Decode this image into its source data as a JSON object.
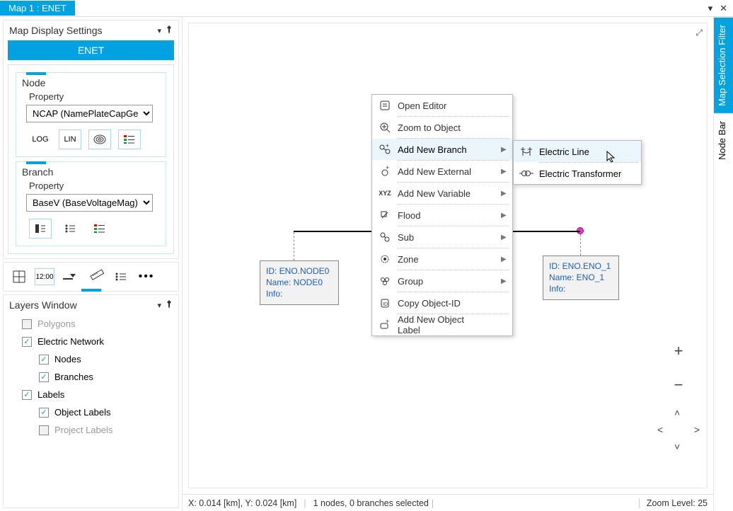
{
  "tab": {
    "title": "Map 1 : ENET"
  },
  "settings_panel": {
    "title": "Map Display Settings",
    "enet_button": "ENET",
    "node": {
      "title": "Node",
      "property_label": "Property",
      "property_value": "NCAP (NamePlateCapGen",
      "buttons": {
        "log": "LOG",
        "lin": "LIN"
      }
    },
    "branch": {
      "title": "Branch",
      "property_label": "Property",
      "property_value": "BaseV (BaseVoltageMag)"
    }
  },
  "toolbar": {
    "time": "12:00"
  },
  "layers_panel": {
    "title": "Layers Window",
    "items": {
      "polygons": "Polygons",
      "electric_network": "Electric Network",
      "nodes": "Nodes",
      "branches": "Branches",
      "labels": "Labels",
      "object_labels": "Object Labels",
      "project_labels": "Project Labels"
    }
  },
  "canvas": {
    "node0": {
      "id": "ID: ENO.NODE0",
      "name": "Name: NODE0",
      "info": "Info:"
    },
    "node1": {
      "id": "ID: ENO.ENO_1",
      "name": "Name: ENO_1",
      "info": "Info:"
    }
  },
  "context_menu": {
    "open_editor": "Open Editor",
    "zoom_to_object": "Zoom to Object",
    "add_new_branch": "Add New Branch",
    "add_new_external": "Add New External",
    "add_new_variable": "Add New Variable",
    "flood": "Flood",
    "sub": "Sub",
    "zone": "Zone",
    "group": "Group",
    "copy_object_id": "Copy Object-ID",
    "add_new_object_label": "Add New Object Label"
  },
  "submenu": {
    "electric_line": "Electric Line",
    "electric_transformer": "Electric Transformer"
  },
  "right_panels": {
    "filter": "Map Selection Filter",
    "nodebar": "Node Bar"
  },
  "status": {
    "coords": "X: 0.014 [km], Y: 0.024 [km]",
    "selection": "1 nodes, 0 branches selected",
    "zoom": "Zoom Level: 25"
  }
}
